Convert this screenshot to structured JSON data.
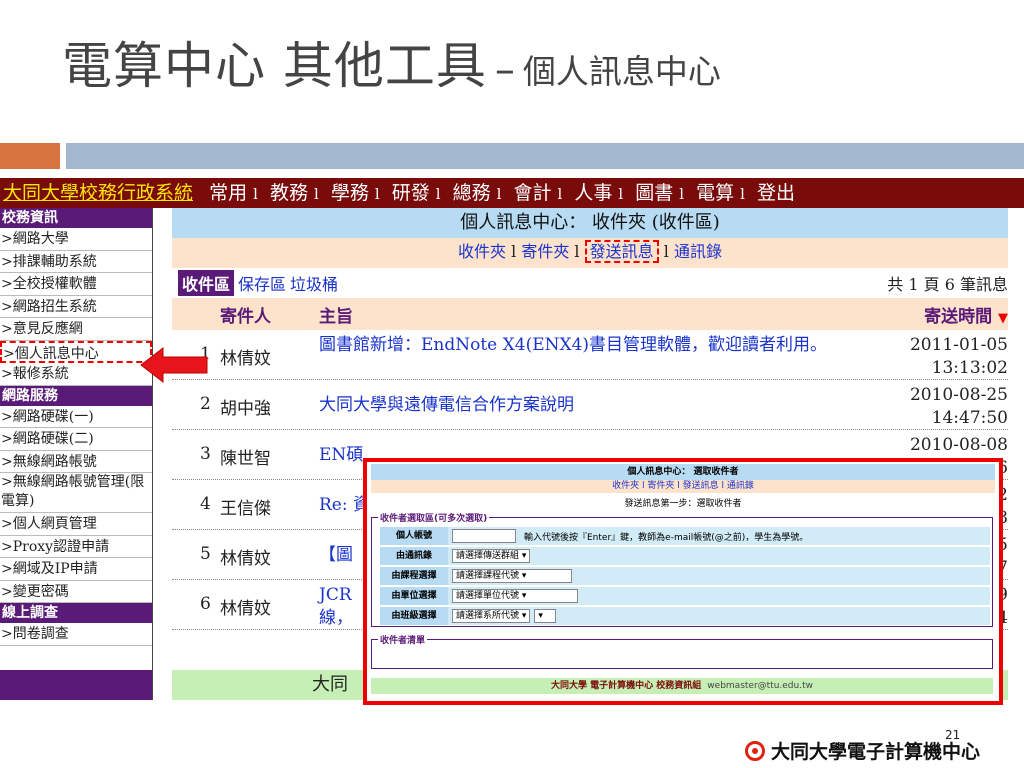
{
  "slide": {
    "title_main": "電算中心 其他工具",
    "title_dash": "–",
    "title_sub": "個人訊息中心",
    "page_number": "21",
    "logo_text": "大同大學電子計算機中心"
  },
  "topnav": {
    "brand": "大同大學校務行政系統",
    "items": [
      "常用",
      "教務",
      "學務",
      "研發",
      "總務",
      "會計",
      "人事",
      "圖書",
      "電算",
      "登出"
    ],
    "separator": "l"
  },
  "sidebar": {
    "section1": "校務資訊",
    "items1": [
      ">網路大學",
      ">排課輔助系統",
      ">全校授權軟體",
      ">網路招生系統",
      ">意見反應網",
      ">個人訊息中心",
      ">報修系統"
    ],
    "section2": "網路服務",
    "items2": [
      ">網路硬碟(一)",
      ">網路硬碟(二)",
      ">無線網路帳號",
      ">無線網路帳號管理(限電算)",
      ">個人網頁管理",
      ">Proxy認證申請",
      ">網域及IP申請",
      ">變更密碼"
    ],
    "section3": "線上調查",
    "items3": [
      ">問卷調查"
    ]
  },
  "main": {
    "header": "個人訊息中心： 收件夾 (收件區)",
    "subtabs": [
      "收件夾",
      "寄件夾",
      "發送訊息",
      "通訊錄"
    ],
    "box_active": "收件區",
    "box_links": [
      "保存區",
      "垃圾桶"
    ],
    "count": "共 1 頁 6 筆訊息",
    "col_sender": "寄件人",
    "col_subject": "主旨",
    "col_time": "寄送時間",
    "sort_icon": "▼",
    "rows": [
      {
        "num": "1",
        "sender": "林倩妏",
        "subject": "圖書館新增：EndNote X4(ENX4)書目管理軟體，歡迎讀者利用。",
        "date": "2011-01-05",
        "time": "13:13:02"
      },
      {
        "num": "2",
        "sender": "胡中強",
        "subject": "大同大學與遠傳電信合作方案說明",
        "date": "2010-08-25",
        "time": "14:47:50"
      },
      {
        "num": "3",
        "sender": "陳世智",
        "subject": "EN碩",
        "date": "2010-08-08",
        "time": "6"
      },
      {
        "num": "4",
        "sender": "王信傑",
        "subject": "Re: 資",
        "date": "2",
        "time": "8"
      },
      {
        "num": "5",
        "sender": "林倩妏",
        "subject": "【圖",
        "date": "5",
        "time": "7"
      },
      {
        "num": "6",
        "sender": "林倩妏",
        "subject": "JCR",
        "subject2": "線，",
        "date": "9",
        "time": "4"
      }
    ],
    "footer": "大同"
  },
  "popup": {
    "header": "個人訊息中心： 選取收件者",
    "tabs": "收件夾 l 寄件夾 l 發送訊息 l 通訊錄",
    "step": "發送訊息第一步：選取收件者",
    "legend": "收件者選取區(可多次選取)",
    "row1_label": "個人帳號",
    "row1_hint": "輸入代號後按『Enter』鍵，教師為e-mail帳號(@之前)，學生為學號。",
    "row2_label": "由通訊錄",
    "row2_select": "請選擇傳送群組",
    "row3_label": "由課程選擇",
    "row3_select": "請選擇課程代號",
    "row4_label": "由單位選擇",
    "row4_select": "請選擇單位代號",
    "row5_label": "由班級選擇",
    "row5_select": "請選擇系所代號",
    "list_legend": "收件者清單",
    "footer": "大同大學 電子計算機中心 校務資訊組",
    "footer_email": "webmaster@ttu.edu.tw"
  }
}
